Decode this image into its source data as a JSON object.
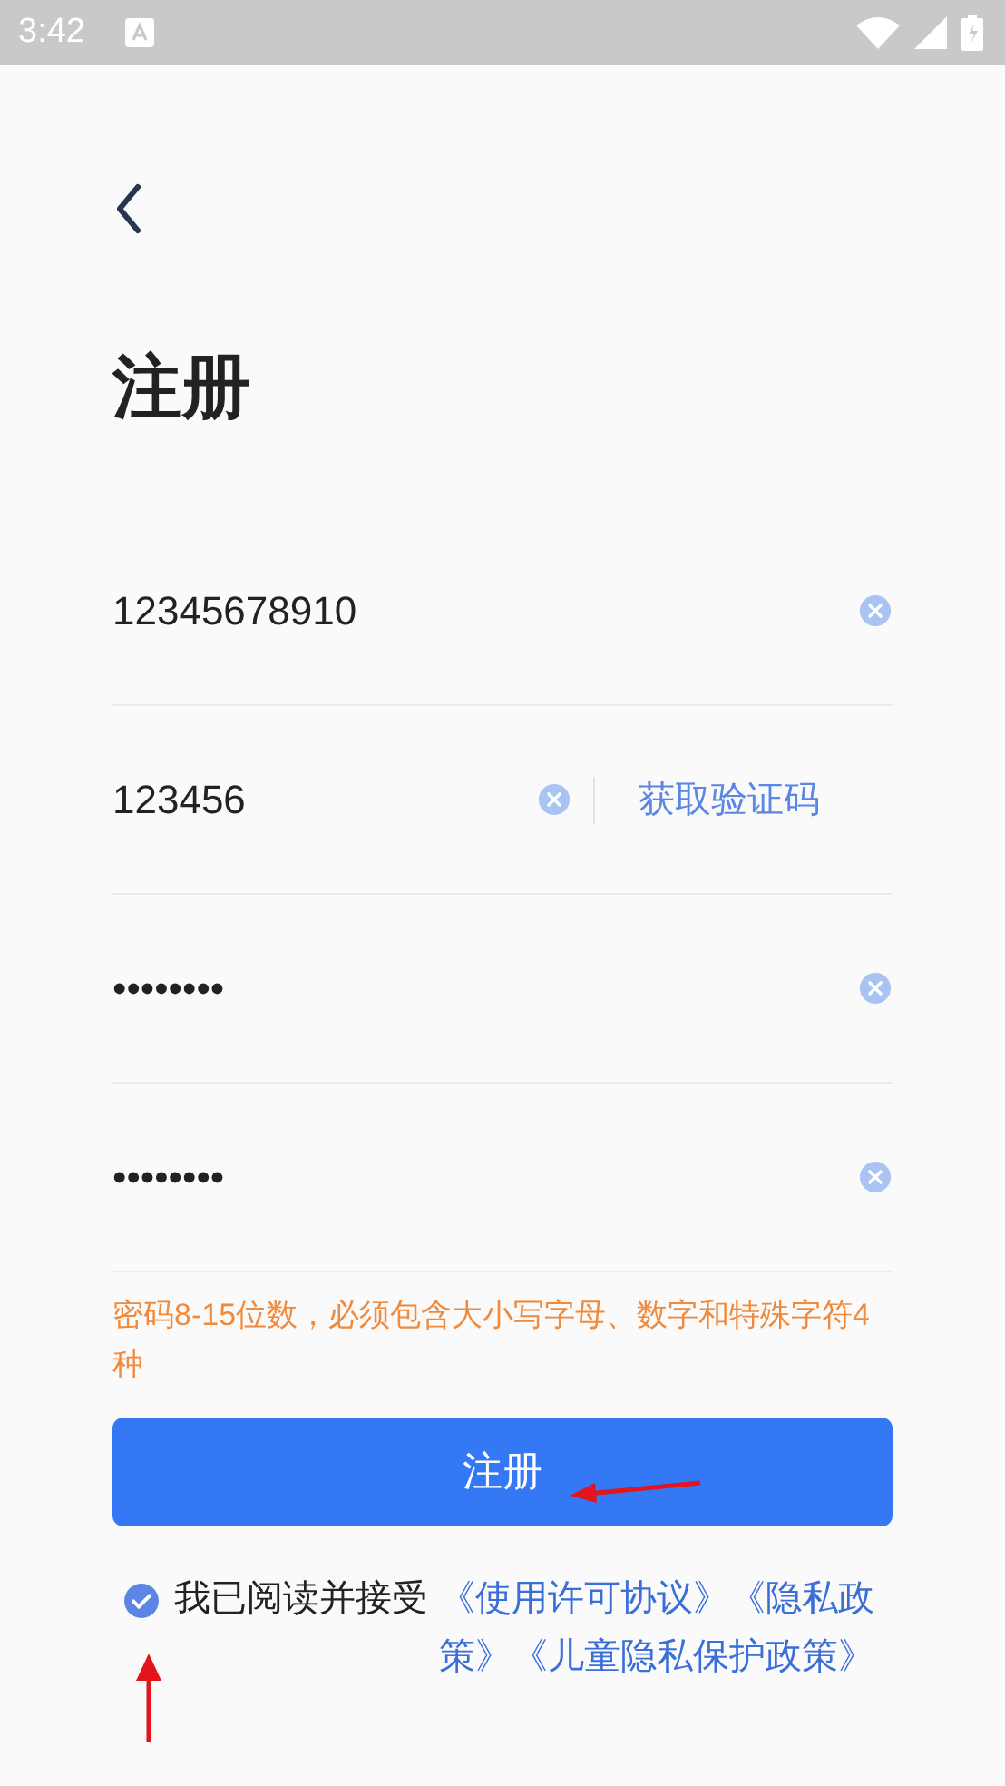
{
  "status_bar": {
    "time": "3:42"
  },
  "title": "注册",
  "fields": [
    {
      "kind": "plain",
      "value": "12345678910"
    },
    {
      "kind": "code",
      "value": "123456",
      "action": "获取验证码"
    },
    {
      "kind": "plain",
      "value": "••••••••"
    },
    {
      "kind": "plain",
      "value": "••••••••"
    }
  ],
  "hint": "密码8-15位数，必须包含大小写字母、数字和特殊字符4种",
  "submit": "注册",
  "agreement": {
    "checked": true,
    "label": "我已阅读并接受",
    "links": "《使用许可协议》《隐私政策》《儿童隐私保护政策》"
  }
}
